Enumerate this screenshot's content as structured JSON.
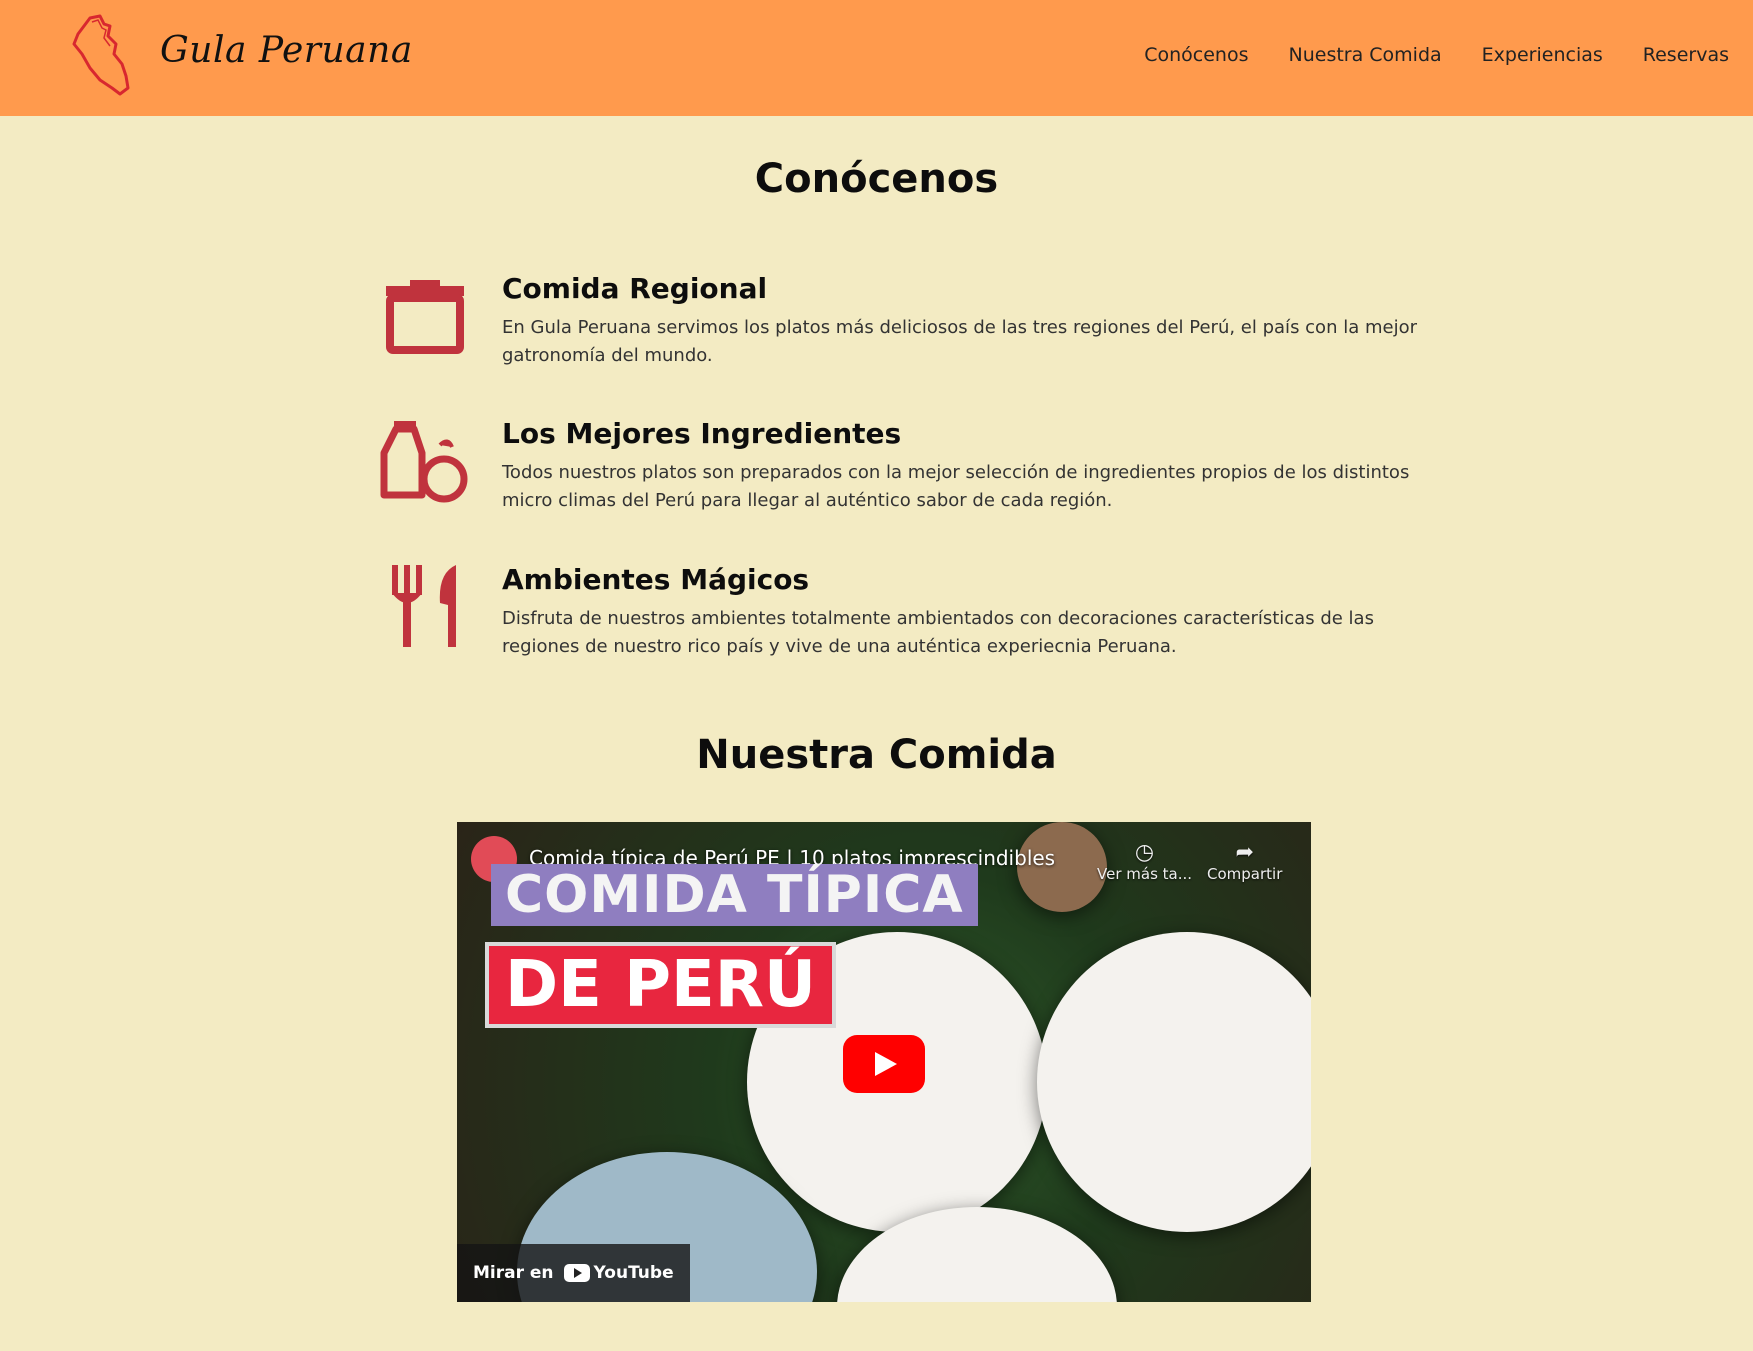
{
  "header": {
    "brand": "Gula Peruana",
    "nav": [
      "Conócenos",
      "Nuestra Comida",
      "Experiencias",
      "Reservas"
    ]
  },
  "conocenos": {
    "title": "Conócenos",
    "features": [
      {
        "title": "Comida Regional",
        "text": "En Gula Peruana servimos los platos más deliciosos de las tres regiones del Perú, el país con la mejor gatronomía del mundo.",
        "icon": "pot-icon"
      },
      {
        "title": "Los Mejores Ingredientes",
        "text": "Todos nuestros platos son preparados con la mejor selección de ingredientes propios de los distintos micro climas del Perú para llegar al auténtico sabor de cada región.",
        "icon": "ingredients-icon"
      },
      {
        "title": "Ambientes Mágicos",
        "text": "Disfruta de nuestros ambientes totalmente ambientados con decoraciones características de las regiones de nuestro rico país y vive de una auténtica experiecnia Peruana.",
        "icon": "cutlery-icon"
      }
    ]
  },
  "comida": {
    "title": "Nuestra Comida",
    "video": {
      "title": "Comida típica de Perú PE | 10 platos imprescindibles",
      "banner_line1": "COMIDA TÍPICA",
      "banner_line2": "DE PERÚ",
      "watch_later": "Ver más ta...",
      "share": "Compartir",
      "watch_on": "Mirar en",
      "youtube": "YouTube"
    }
  },
  "colors": {
    "header_bg": "#ff9a4d",
    "page_bg": "#f3ebc3",
    "icon_red": "#c0333d"
  }
}
